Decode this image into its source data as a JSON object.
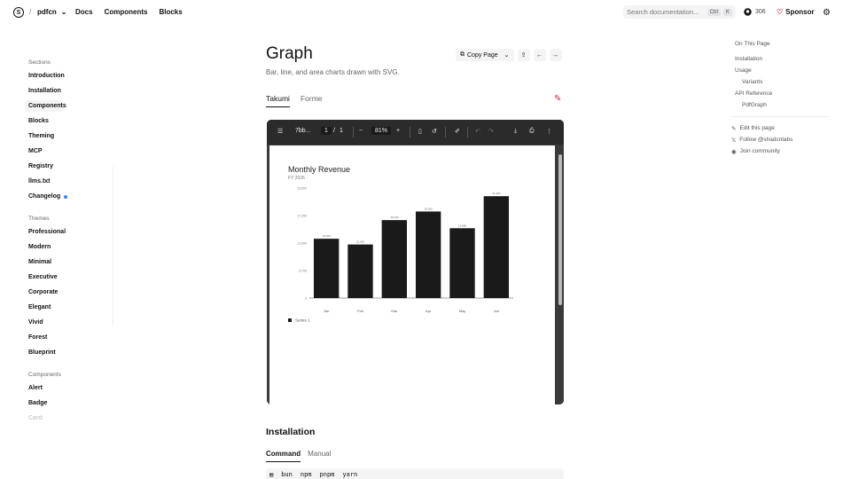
{
  "header": {
    "logo": "S",
    "brand": "pdfcn",
    "nav": [
      "Docs",
      "Components",
      "Blocks"
    ],
    "search_placeholder": "Search documentation...",
    "search_kbd": [
      "Ctrl",
      "K"
    ],
    "github_count": "306",
    "sponsor": "Sponsor"
  },
  "sidebar": {
    "sections_head": "Sections",
    "sections": [
      "Introduction",
      "Installation",
      "Components",
      "Blocks",
      "Theming",
      "MCP",
      "Registry",
      "llms.txt",
      "Changelog"
    ],
    "themes_head": "Themes",
    "themes": [
      "Professional",
      "Modern",
      "Minimal",
      "Executive",
      "Corporate",
      "Elegant",
      "Vivid",
      "Forest",
      "Blueprint"
    ],
    "components_head": "Components",
    "components": [
      "Alert",
      "Badge",
      "Card"
    ]
  },
  "page": {
    "title": "Graph",
    "subtitle": "Bar, line, and area charts drawn with SVG.",
    "copy_page": "Copy Page",
    "tabs": [
      "Takumi",
      "Forme"
    ]
  },
  "viewer": {
    "filename": "7bb...",
    "page_current": "1",
    "page_sep": "/",
    "page_total": "1",
    "zoom": "81%"
  },
  "chart_data": {
    "type": "bar",
    "title": "Monthly Revenue",
    "subtitle": "FY 2026",
    "categories": [
      "Jan",
      "Feb",
      "Mar",
      "Apr",
      "May",
      "Jun"
    ],
    "series": [
      {
        "name": "Series 1",
        "values": [
          12400,
          11200,
          16300,
          18100,
          14600,
          21300
        ]
      }
    ],
    "data_labels": [
      "12,400",
      "11,200",
      "16,300",
      "18,100",
      "14,600",
      "21,300"
    ],
    "yticks": [
      "0",
      "5,750",
      "11,500",
      "17,250",
      "23,000"
    ],
    "ylim": [
      0,
      23000
    ],
    "legend": "bottom-left"
  },
  "installation": {
    "title": "Installation",
    "tabs": [
      "Command",
      "Manual"
    ],
    "package_managers": [
      "bun",
      "npm",
      "pnpm",
      "yarn"
    ]
  },
  "toc": {
    "head": "On This Page",
    "items": [
      {
        "label": "Installation",
        "sub": false
      },
      {
        "label": "Usage",
        "sub": false
      },
      {
        "label": "Variants",
        "sub": true
      },
      {
        "label": "API Reference",
        "sub": false
      },
      {
        "label": "PdfGraph",
        "sub": true
      }
    ],
    "links": [
      "Edit this page",
      "Follow @shadcnlabs",
      "Join community"
    ]
  },
  "colors": {
    "bar": "#1a1a1a",
    "accent": "#3b82f6",
    "sponsor": "#e11d48"
  }
}
